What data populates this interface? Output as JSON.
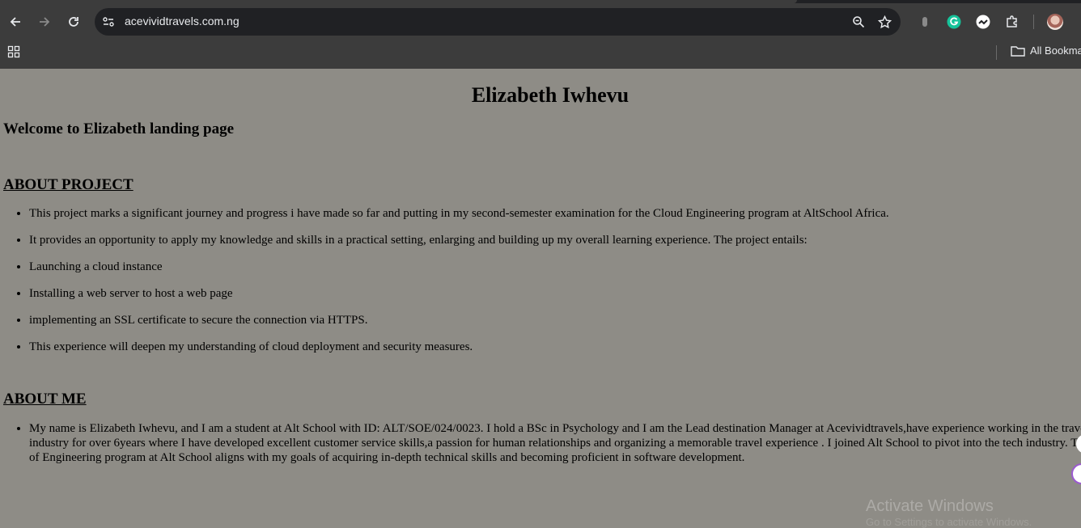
{
  "browser": {
    "url": "acevividtravels.com.ng",
    "bookmarks_label": "All Bookmarks"
  },
  "page": {
    "title": "Elizabeth Iwhevu",
    "welcome": "Welcome to Elizabeth landing page",
    "about_project": {
      "heading": "ABOUT PROJECT",
      "items": [
        "This project marks a significant journey and progress i have made so far and putting in my second-semester examination for the Cloud Engineering program at AltSchool Africa.",
        "It provides an opportunity to apply my knowledge and skills in a practical setting, enlarging and building up my overall learning experience. The project entails:",
        "Launching a cloud instance",
        "Installing a web server to host a web page",
        "implementing an SSL certificate to secure the connection via HTTPS.",
        "This experience will deepen my understanding of cloud deployment and security measures."
      ]
    },
    "about_me": {
      "heading": "ABOUT ME",
      "items": [
        "My name is Elizabeth Iwhevu, and I am a student at Alt School with ID: ALT/SOE/024/0023. I hold a BSc in Psychology and I am the Lead destination Manager at Acevividtravels,have experience working in the travel industry for over 6years where I have developed excellent customer service skills,a passion for human relationships and organizing a memorable travel experience . I joined Alt School to pivot into the tech industry. The School of Engineering program at Alt School aligns with my goals of acquiring in-depth technical skills and becoming proficient in software development."
      ]
    }
  },
  "overlay": {
    "activate_title": "Activate Windows",
    "activate_subtitle": "Go to Settings to activate Windows."
  },
  "colors": {
    "page_background": "#8e8c86",
    "chrome_toolbar": "#3c3c3c",
    "omnibox": "#202124"
  },
  "icons": [
    "back-arrow-icon",
    "forward-arrow-icon",
    "reload-icon",
    "site-info-icon",
    "zoom-icon",
    "bookmark-star-icon",
    "extension-dot-icon",
    "grammarly-icon",
    "extension-icon",
    "puzzle-icon",
    "profile-avatar",
    "apps-grid-icon",
    "folder-icon"
  ]
}
